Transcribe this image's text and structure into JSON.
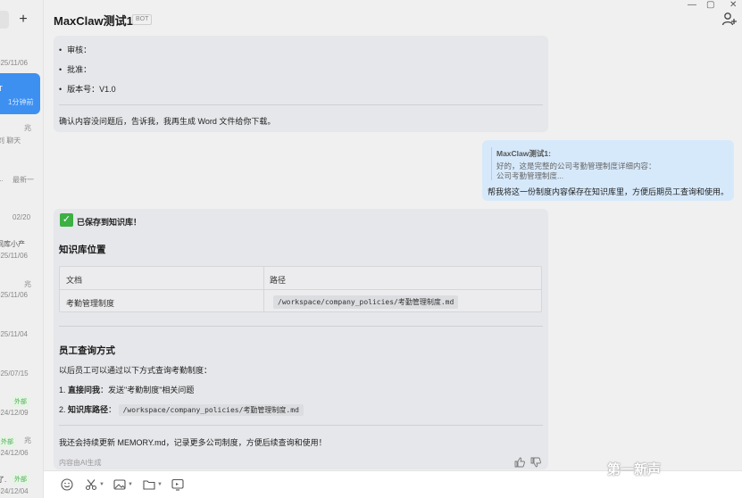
{
  "app": {
    "title": "MaxClaw测试1",
    "badge": "BOT",
    "window_controls": {
      "minimize": "—",
      "maximize": "▢",
      "close": "✕"
    }
  },
  "sidebar": {
    "new_button": "+",
    "items": [
      {
        "line1": "025/11/06",
        "line2": ""
      },
      {
        "line1": "T",
        "line2": "1分钟前",
        "selected": true
      },
      {
        "line1": "兆",
        "line2": "刘    聊天"
      },
      {
        "line1": "...",
        "line2": "最新一"
      },
      {
        "line1": "",
        "line2": "02/20"
      },
      {
        "line1": "间库小产",
        "line2": "025/11/06"
      },
      {
        "line1": "兆",
        "line2": "025/11/06"
      },
      {
        "line1": "",
        "line2": "025/11/04"
      },
      {
        "line1": "",
        "line2": "025/07/15"
      },
      {
        "line1": "外部",
        "line2": "024/12/09"
      },
      {
        "line1": "外部",
        "line2": "024/12/06",
        "extra": "兆"
      },
      {
        "line1": "了.",
        "line2": "024/12/04",
        "extra": "外部"
      }
    ]
  },
  "messages": {
    "bot1": {
      "bullets": [
        "审核：",
        "批准：",
        "版本号：V1.0"
      ],
      "confirm": "确认内容没问题后，告诉我，我再生成 Word 文件给你下载。"
    },
    "user1": {
      "quote_name": "MaxClaw测试1:",
      "quote_lines": [
        "好的，这是完整的公司考勤管理制度详细内容：",
        "公司考勤管理制度..."
      ],
      "text": "帮我将这一份制度内容保存在知识库里，方便后期员工查询和使用。"
    },
    "bot2": {
      "saved": "已保存到知识库！",
      "kb_location_title": "知识库位置",
      "table": {
        "headers": [
          "文档",
          "路径"
        ],
        "rows": [
          [
            "考勤管理制度",
            "/workspace/company_policies/考勤管理制度.md"
          ]
        ]
      },
      "query_title": "员工查询方式",
      "intro": "以后员工可以通过以下方式查询考勤制度：",
      "steps": [
        {
          "num": "1.",
          "bold": "直接问我",
          "rest": "：发送\"考勤制度\"相关问题"
        },
        {
          "num": "2.",
          "bold": "知识库路径",
          "rest": "：",
          "code": "/workspace/company_policies/考勤管理制度.md"
        }
      ],
      "closing": "我还会持续更新 MEMORY.md，记录更多公司制度，方便后续查询和使用！",
      "ai_note": "内容由AI生成"
    }
  },
  "composer": {
    "icons": [
      "emoji-icon",
      "scissors-icon",
      "image-icon",
      "folder-icon",
      "screen-icon"
    ]
  },
  "watermark": "第一新声"
}
